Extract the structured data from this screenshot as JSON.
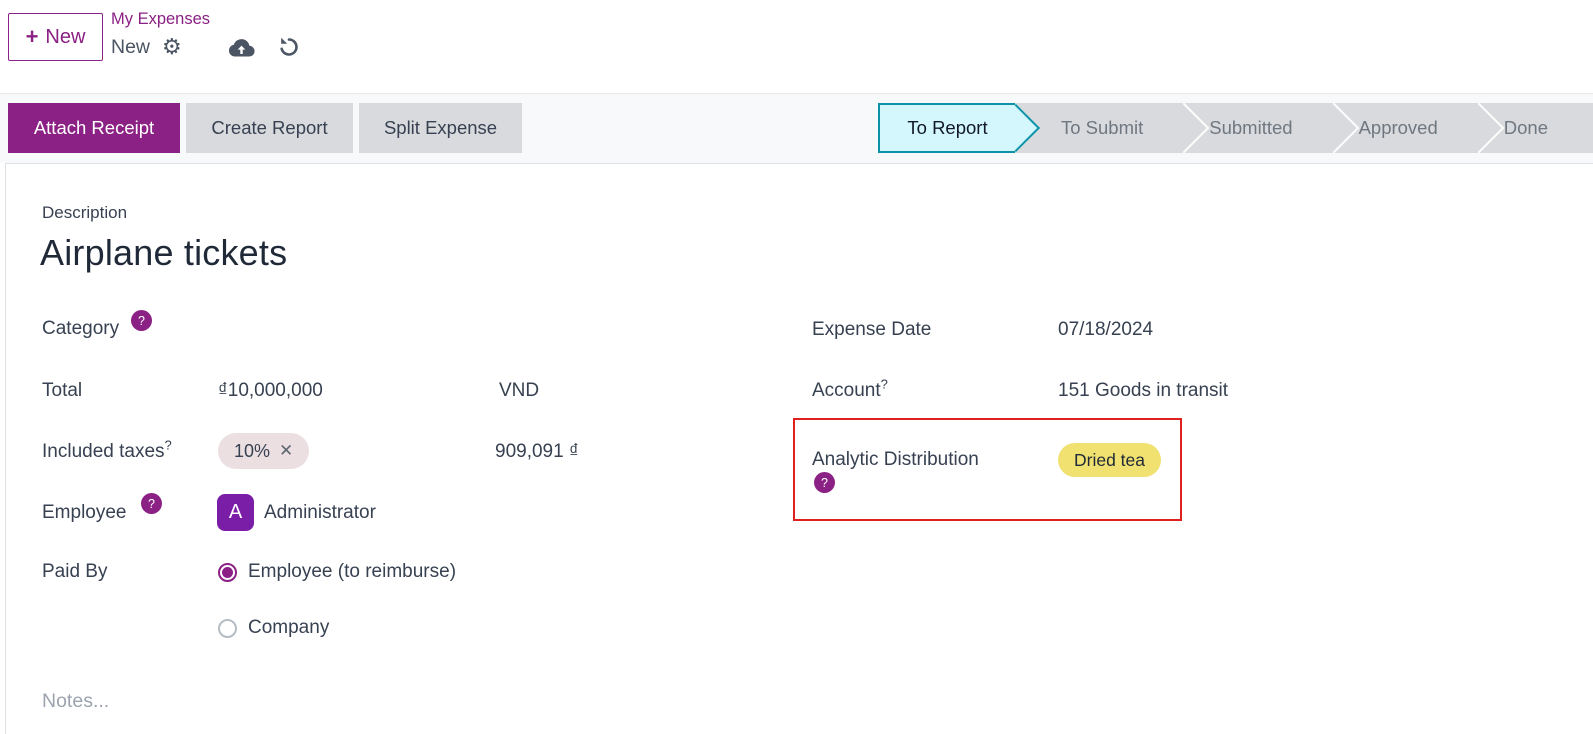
{
  "header": {
    "new_button": {
      "icon": "+",
      "label": "New"
    },
    "breadcrumb": {
      "parent": "My Expenses",
      "current": "New"
    },
    "gear_icon_glyph": "⚙"
  },
  "action_bar": {
    "buttons": [
      {
        "label": "Attach Receipt",
        "style": "primary"
      },
      {
        "label": "Create Report",
        "style": "secondary"
      },
      {
        "label": "Split Expense",
        "style": "secondary"
      }
    ]
  },
  "statusbar": {
    "active_stage": "To Report",
    "stages": [
      {
        "label": "To Report",
        "active": true
      },
      {
        "label": "To Submit",
        "active": false
      },
      {
        "label": "Submitted",
        "active": false
      },
      {
        "label": "Approved",
        "active": false
      },
      {
        "label": "Done",
        "active": false
      }
    ]
  },
  "form": {
    "description": {
      "label": "Description",
      "value": "Airplane tickets"
    },
    "category": {
      "label": "Category",
      "help": "?"
    },
    "total": {
      "label": "Total",
      "amount": "₫10,000,000",
      "currency": "VND"
    },
    "included_taxes": {
      "label": "Included taxes",
      "help": "?",
      "tax_tag": "10%",
      "remove_icon": "✕",
      "tax_amount": "909,091 ₫"
    },
    "employee": {
      "label": "Employee",
      "help": "?",
      "avatar_initial": "A",
      "value": "Administrator"
    },
    "paid_by": {
      "label": "Paid By",
      "options": [
        {
          "label": "Employee (to reimburse)",
          "selected": true
        },
        {
          "label": "Company",
          "selected": false
        }
      ]
    },
    "notes": {
      "placeholder": "Notes..."
    },
    "expense_date": {
      "label": "Expense Date",
      "value": "07/18/2024"
    },
    "account": {
      "label": "Account",
      "help": "?",
      "value": "151 Goods in transit"
    },
    "analytic_distribution": {
      "label": "Analytic Distribution",
      "help": "?",
      "tag": "Dried tea",
      "highlighted": true
    }
  },
  "colors": {
    "accent_purple": "#8b2184",
    "avatar_purple": "#7a1ea8",
    "stage_active_bg": "#d4f7fd",
    "stage_active_border": "#0c93a7",
    "stage_gray_bg": "#d8dadd",
    "secondary_button_bg": "#d8dadd",
    "tax_tag_bg": "#ebdfe2",
    "analytic_tag_bg": "#f0e170",
    "highlight_red": "#e01f1f"
  }
}
